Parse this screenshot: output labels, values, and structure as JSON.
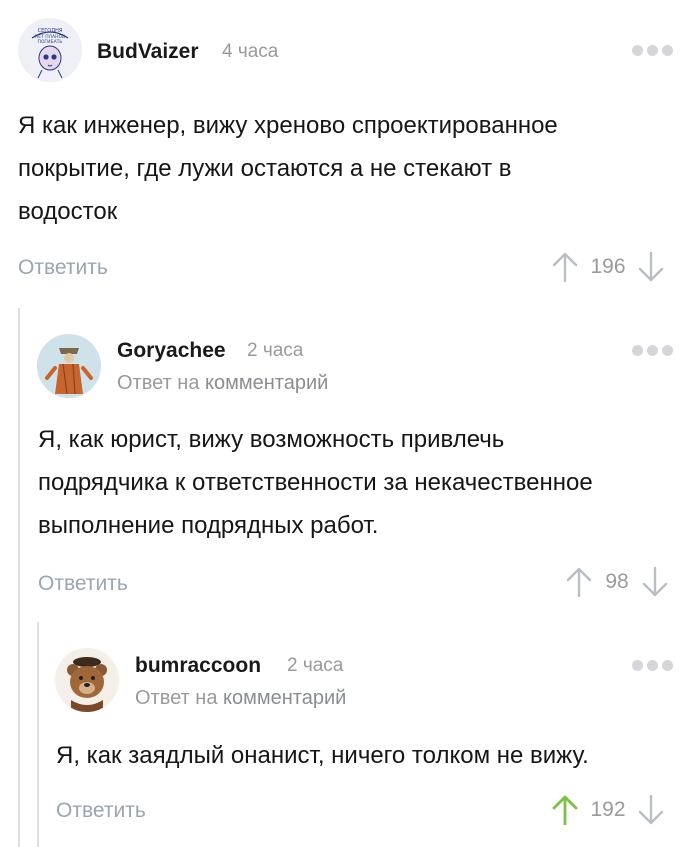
{
  "comments": [
    {
      "author": "BudVaizer",
      "time": "4 часа",
      "avatar_caption": "СЕГОДНЯ НЕТ ПЛАНОВ ПОГИБАТЬ",
      "body_lines": [
        "Я как инженер, вижу хреново спроектированное",
        "покрытие, где лужи остаются а не стекают в",
        "водосток"
      ],
      "reply_label": "Ответить",
      "rating": "196"
    },
    {
      "author": "Goryachee",
      "time": "2 часа",
      "reply_to_prefix": "Ответ на",
      "reply_to_link": "комментарий",
      "body_lines": [
        "Я, как юрист, вижу возможность привлечь",
        "подрядчика к ответственности за некачественное",
        "выполнение подрядных работ."
      ],
      "reply_label": "Ответить",
      "rating": "98"
    },
    {
      "author": "bumraccoon",
      "time": "2 часа",
      "reply_to_prefix": "Ответ на",
      "reply_to_link": "комментарий",
      "body_lines": [
        "Я, как заядлый онанист, ничего толком не вижу."
      ],
      "reply_label": "Ответить",
      "rating": "192",
      "upvoted": true
    }
  ],
  "colors": {
    "upvote_active": "#7bc142",
    "arrow_inactive": "#b9bec4",
    "thread_line": "#dedede"
  }
}
